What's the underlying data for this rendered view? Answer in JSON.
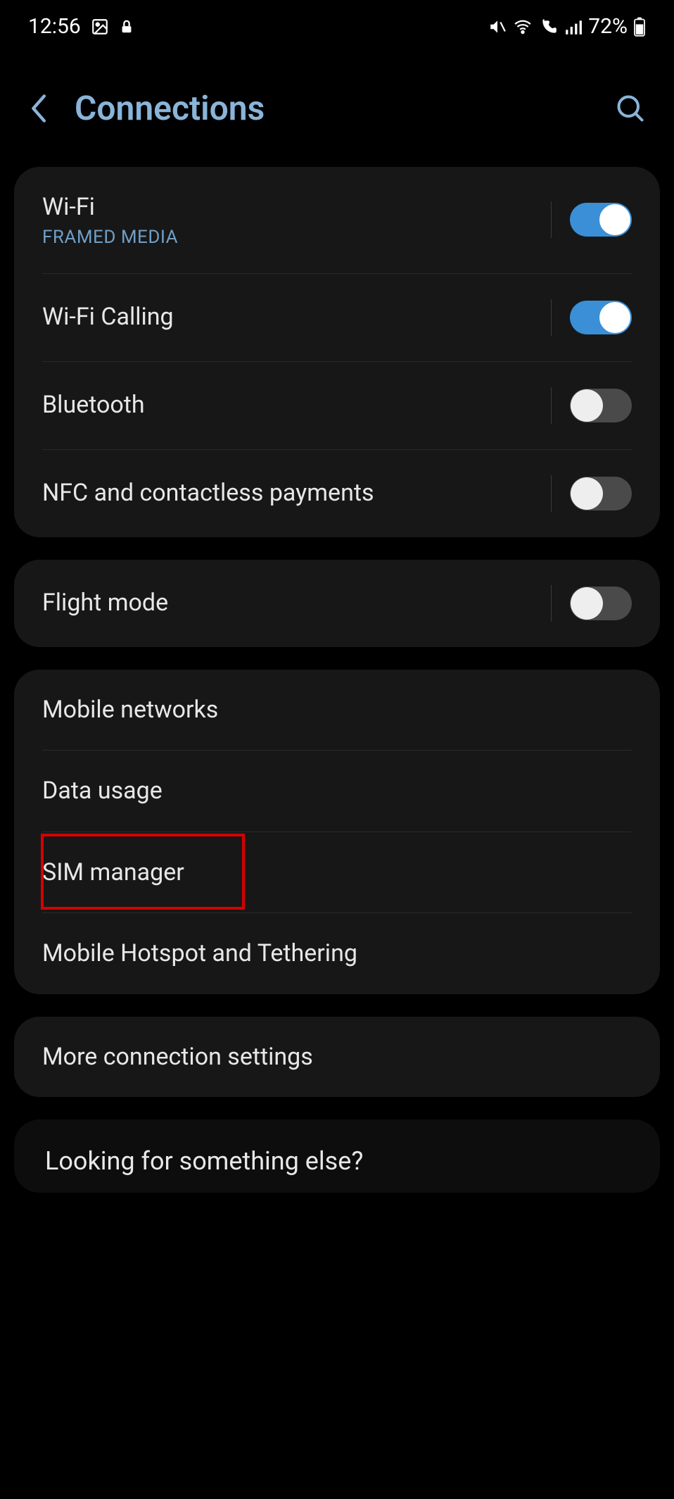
{
  "status": {
    "time": "12:56",
    "battery": "72%"
  },
  "header": {
    "title": "Connections"
  },
  "groups": [
    {
      "rows": [
        {
          "label": "Wi-Fi",
          "sub": "FRAMED MEDIA",
          "toggle": true,
          "toggle_on": true
        },
        {
          "label": "Wi-Fi Calling",
          "toggle": true,
          "toggle_on": true
        },
        {
          "label": "Bluetooth",
          "toggle": true,
          "toggle_on": false
        },
        {
          "label": "NFC and contactless payments",
          "toggle": true,
          "toggle_on": false
        }
      ]
    },
    {
      "rows": [
        {
          "label": "Flight mode",
          "toggle": true,
          "toggle_on": false
        }
      ]
    },
    {
      "rows": [
        {
          "label": "Mobile networks",
          "toggle": false
        },
        {
          "label": "Data usage",
          "toggle": false
        },
        {
          "label": "SIM manager",
          "toggle": false,
          "highlighted": true
        },
        {
          "label": "Mobile Hotspot and Tethering",
          "toggle": false
        }
      ]
    },
    {
      "rows": [
        {
          "label": "More connection settings",
          "toggle": false
        }
      ]
    }
  ],
  "footer": {
    "prompt": "Looking for something else?"
  }
}
